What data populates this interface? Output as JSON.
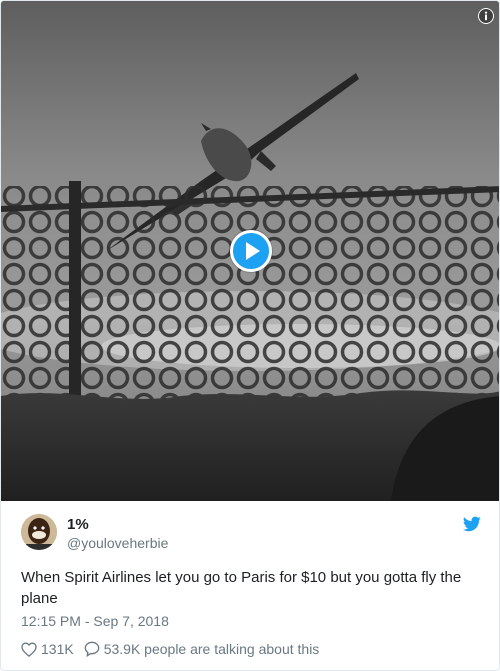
{
  "media": {
    "play_icon": "play-icon",
    "info_icon": "info-icon"
  },
  "author": {
    "name": "1%",
    "handle": "@youloveherbie",
    "avatar_icon": "avatar"
  },
  "tweet": {
    "text": "When Spirit Airlines let you go to Paris for $10 but you gotta fly the plane",
    "timestamp": "12:15 PM - Sep 7, 2018"
  },
  "actions": {
    "likes": "131K",
    "talking": "53.9K people are talking about this"
  },
  "colors": {
    "brand": "#1da1f2",
    "secondary_text": "#697882",
    "primary_text": "#1c2022"
  }
}
